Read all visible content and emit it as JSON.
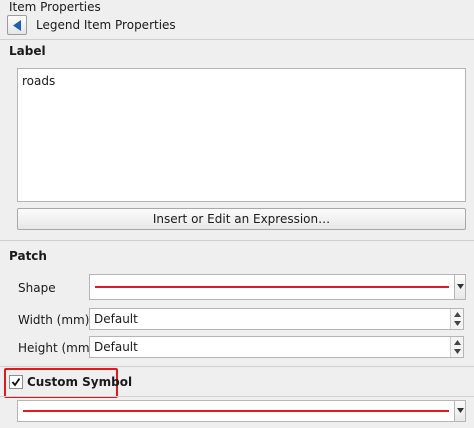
{
  "header": {
    "title": "Item Properties",
    "subtitle": "Legend Item Properties"
  },
  "label_section": {
    "title": "Label",
    "text": "roads",
    "expression_button": "Insert or Edit an Expression…"
  },
  "patch_section": {
    "title": "Patch",
    "shape_label": "Shape",
    "width_label": "Width (mm)",
    "width_value": "Default",
    "height_label": "Height (mm)",
    "height_value": "Default",
    "line_color": "#e31a1c"
  },
  "custom_symbol": {
    "label": "Custom Symbol",
    "checked": true,
    "line_color": "#e31a1c"
  }
}
